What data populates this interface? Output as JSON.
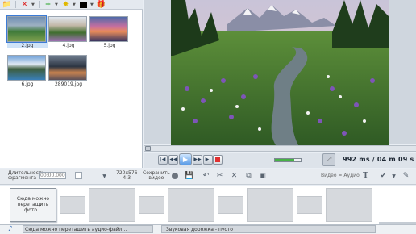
{
  "thumbnails": [
    {
      "caption": "2.jpg",
      "selected": true
    },
    {
      "caption": "4.jpg",
      "selected": false
    },
    {
      "caption": "5.jpg",
      "selected": false
    },
    {
      "caption": "6.jpg",
      "selected": false
    },
    {
      "caption": "289019.jpg",
      "selected": false
    }
  ],
  "player": {
    "time": "992 ms",
    "duration": "/ 04 m 09 s"
  },
  "edit": {
    "duration_label_1": "Длительность",
    "duration_label_2": "фрагмента",
    "duration_value": "00:00.000",
    "resolution": "720x576",
    "aspect": "4:3",
    "save_video_1": "Сохранить",
    "save_video_2": "видео",
    "video_audio": "Видео = Аудио"
  },
  "timeline": {
    "drop_photo_1": "Сюда можно",
    "drop_photo_2": "перетащить",
    "drop_photo_3": "фото...",
    "drop_audio": "Сюда можно перетащить аудио-файл...",
    "audio_track": "Звуковая дорожка - пусто"
  },
  "colors": {
    "accent": "#3b7bd6",
    "volume": "#47b247",
    "stop": "#e03030"
  }
}
